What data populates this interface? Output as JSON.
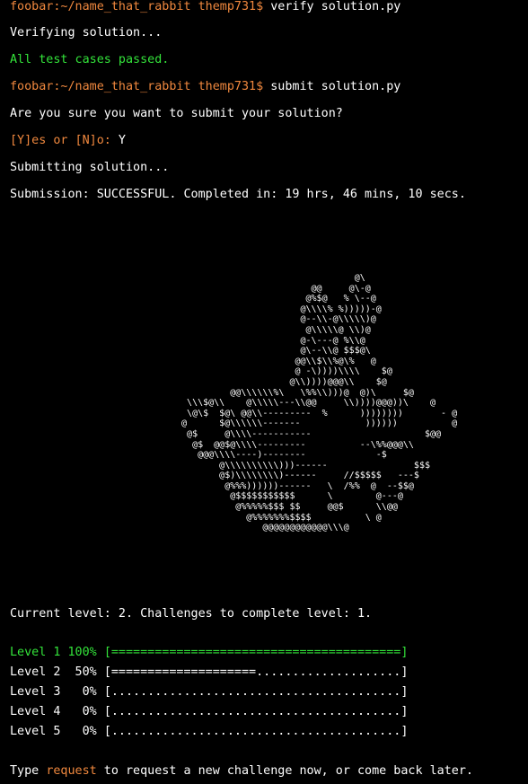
{
  "prompt": "foobar:~/name_that_rabbit themp731$",
  "cmd_verify": " verify solution.py",
  "verifying": "Verifying solution...",
  "passed": "All test cases passed.",
  "cmd_submit": " submit solution.py",
  "confirm_question": "Are you sure you want to submit your solution?",
  "yes_no_prompt": "[Y]es or [N]o:",
  "yes_no_answer": " Y",
  "submitting": "Submitting solution...",
  "submission_result": "Submission: SUCCESSFUL. Completed in: 19 hrs, 46 mins, 10 secs.",
  "ascii_art": "                                  @\\\n                          @@     @\\-@\n                         @%$@   % \\--@\n                        @\\\\\\\\% %)))))-@\n                        @--\\\\-@\\\\\\\\\\)@\n                         @\\\\\\\\\\@ \\\\)@\n                        @-\\---@ %\\\\@\n                        @\\--\\\\@ $$$@\\\n                       @@\\\\$\\\\%@\\%   @\n                       @ -\\))))\\\\\\\\    $@\n                      @\\\\))))@@@\\\\    $@\n           @@\\\\\\\\\\\\%\\   \\%%\\\\)))@  @)\\     $@\n   \\\\\\$@\\\\    @\\\\\\\\\\---\\\\@@     \\\\))))@@@))\\    @\n   \\@\\$  $@\\ @@\\\\---------  %      ))))))))       - @\n  @      $@\\\\\\\\\\\\-------            ))))))          @\n   @$     @\\\\\\\\-----------                     $@@\n    @$  @@$@\\\\\\\\---------          --\\%%@@@\\\\\n     @@@\\\\\\\\----)--------             -$\n         @\\\\\\\\\\\\\\\\\\\\)))------                $$$\n         @$)\\\\\\\\\\\\\\\\)------     //$$$$$   ---$\n          @%%%))))))------   \\  /%%  @  --$$@\n           @$$$$$$$$$$$      \\        @---@\n            @%%%%%$$$ $$     @@$      \\\\@@\n              @%%%%%%%$$$$          \\ @\n                 @@@@@@@@@@@@\\\\\\@",
  "current_level": "Current level: 2. Challenges to complete level: 1.",
  "levels": [
    {
      "label": "Level 1 100%",
      "bar": "[========================================]",
      "progress": 1.0
    },
    {
      "label": "Level 2  50%",
      "bar": "[====================....................]",
      "progress": 0.5
    },
    {
      "label": "Level 3   0%",
      "bar": "[........................................]",
      "progress": 0.0
    },
    {
      "label": "Level 4   0%",
      "bar": "[........................................]",
      "progress": 0.0
    },
    {
      "label": "Level 5   0%",
      "bar": "[........................................]",
      "progress": 0.0
    }
  ],
  "footer": {
    "pre": "Type ",
    "keyword": "request",
    "post": " to request a new challenge now, or come back later."
  }
}
